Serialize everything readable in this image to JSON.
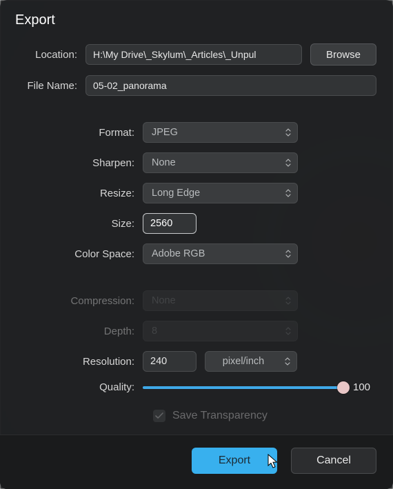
{
  "dialog": {
    "title": "Export"
  },
  "location": {
    "label": "Location:",
    "value": "H:\\My Drive\\_Skylum\\_Articles\\_Unpul",
    "browse": "Browse"
  },
  "filename": {
    "label": "File Name:",
    "value": "05-02_panorama"
  },
  "format": {
    "label": "Format:",
    "value": "JPEG"
  },
  "sharpen": {
    "label": "Sharpen:",
    "value": "None"
  },
  "resize": {
    "label": "Resize:",
    "value": "Long Edge"
  },
  "size": {
    "label": "Size:",
    "value": "2560"
  },
  "colorspace": {
    "label": "Color Space:",
    "value": "Adobe RGB"
  },
  "compression": {
    "label": "Compression:",
    "value": "None"
  },
  "depth": {
    "label": "Depth:",
    "value": "8"
  },
  "resolution": {
    "label": "Resolution:",
    "value": "240",
    "unit": "pixel/inch"
  },
  "quality": {
    "label": "Quality:",
    "value": "100"
  },
  "save_transparency": {
    "label": "Save Transparency",
    "checked": true
  },
  "footer": {
    "export": "Export",
    "cancel": "Cancel"
  },
  "colors": {
    "accent": "#38b0ee"
  }
}
